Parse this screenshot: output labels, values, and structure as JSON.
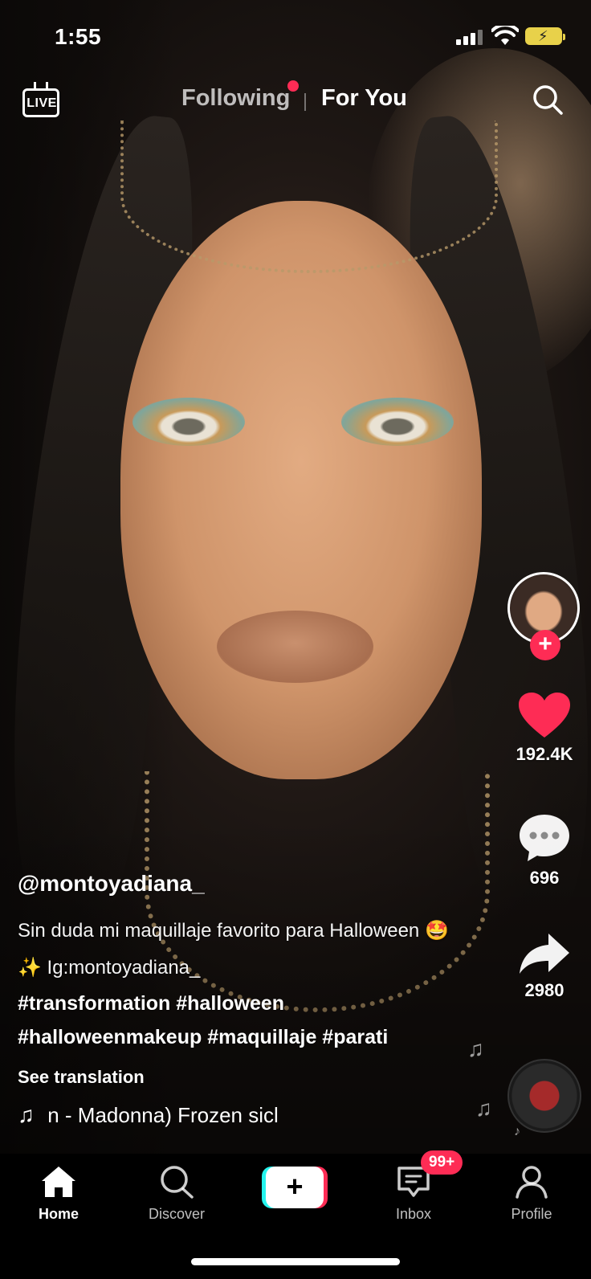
{
  "status_bar": {
    "time": "1:55"
  },
  "top_nav": {
    "live_label": "LIVE",
    "tabs": [
      {
        "label": "Following",
        "active": false
      },
      {
        "label": "For You",
        "active": true
      }
    ]
  },
  "video": {
    "username": "@montoyadiana_",
    "description": "Sin duda mi maquillaje favorito para Halloween 🤩✨ Ig:montoyadiana_",
    "hashtags": "#transformation #halloween #halloweenmakeup #maquillaje #parati",
    "see_translation": "See translation",
    "music_track": "n - Madonna)    Frozen sicl"
  },
  "rail": {
    "likes": "192.4K",
    "comments": "696",
    "shares": "2980"
  },
  "bottom_nav": {
    "items": [
      {
        "label": "Home",
        "active": true
      },
      {
        "label": "Discover",
        "active": false
      },
      {
        "label": "Inbox",
        "active": false,
        "badge": "99+"
      },
      {
        "label": "Profile",
        "active": false
      }
    ]
  },
  "colors": {
    "accent": "#fe2c55",
    "cyan": "#25f4ee"
  }
}
